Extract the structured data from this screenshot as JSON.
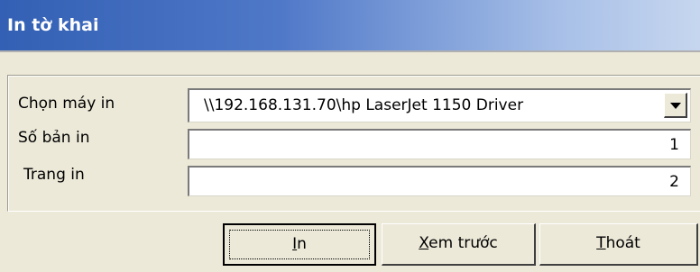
{
  "window": {
    "title": "In tờ khai"
  },
  "form": {
    "printer_label": "Chọn máy in",
    "printer_value": "\\\\192.168.131.70\\hp LaserJet 1150 Driver",
    "copies_label": "Số bản in",
    "copies_value": "1",
    "pages_label": "Trang in",
    "pages_value": "2"
  },
  "buttons": {
    "print_mnemonic": "I",
    "print_rest": "n",
    "preview_mnemonic": "X",
    "preview_rest": "em trước",
    "exit_mnemonic": "T",
    "exit_rest": "hoát"
  },
  "colors": {
    "dialog_bg": "#ece9d8",
    "title_start": "#3360b4",
    "title_end": "#c6d6ee"
  },
  "icons": {
    "dropdown": "chevron-down-icon"
  }
}
